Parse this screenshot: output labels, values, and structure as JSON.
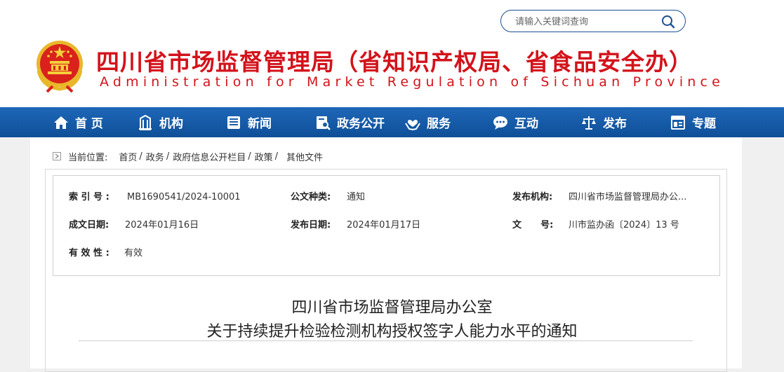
{
  "header": {
    "title_cn": "四川省市场监督管理局（省知识产权局、省食品安全办）",
    "title_en": "Administration for Market Regulation of Sichuan Province",
    "search_placeholder": "请输入关键词查询",
    "brand_color": "#d3131b"
  },
  "nav": {
    "color": "#1a5ca8",
    "items": [
      {
        "label": "首 页",
        "icon": "home-icon"
      },
      {
        "label": "机构",
        "icon": "building-icon"
      },
      {
        "label": "新闻",
        "icon": "news-icon"
      },
      {
        "label": "政务公开",
        "icon": "document-search-icon"
      },
      {
        "label": "服务",
        "icon": "heart-hands-icon"
      },
      {
        "label": "互动",
        "icon": "chat-icon"
      },
      {
        "label": "发布",
        "icon": "scales-icon"
      },
      {
        "label": "专题",
        "icon": "window-icon"
      }
    ]
  },
  "breadcrumb": {
    "label": "当前位置:",
    "items": [
      "首页",
      "政务",
      "政府信息公开栏目",
      "政策",
      "其他文件"
    ]
  },
  "meta": {
    "index_label": "索 引 号 :",
    "index_value": "MB1690541/2024-10001",
    "type_label": "公文种类:",
    "type_value": "通知",
    "publisher_label": "发布机构:",
    "publisher_value": "四川省市场监督管理局办公...",
    "created_label": "成文日期:",
    "created_value": "2024年01月16日",
    "published_label": "发布日期:",
    "published_value": "2024年01月17日",
    "docno_label": "文      号:",
    "docno_value": "川市监办函〔2024〕13 号",
    "validity_label": "有 效 性 :",
    "validity_value": "有效"
  },
  "document": {
    "title_line1": "四川省市场监督管理局办公室",
    "title_line2": "关于持续提升检验检测机构授权签字人能力水平的通知"
  }
}
